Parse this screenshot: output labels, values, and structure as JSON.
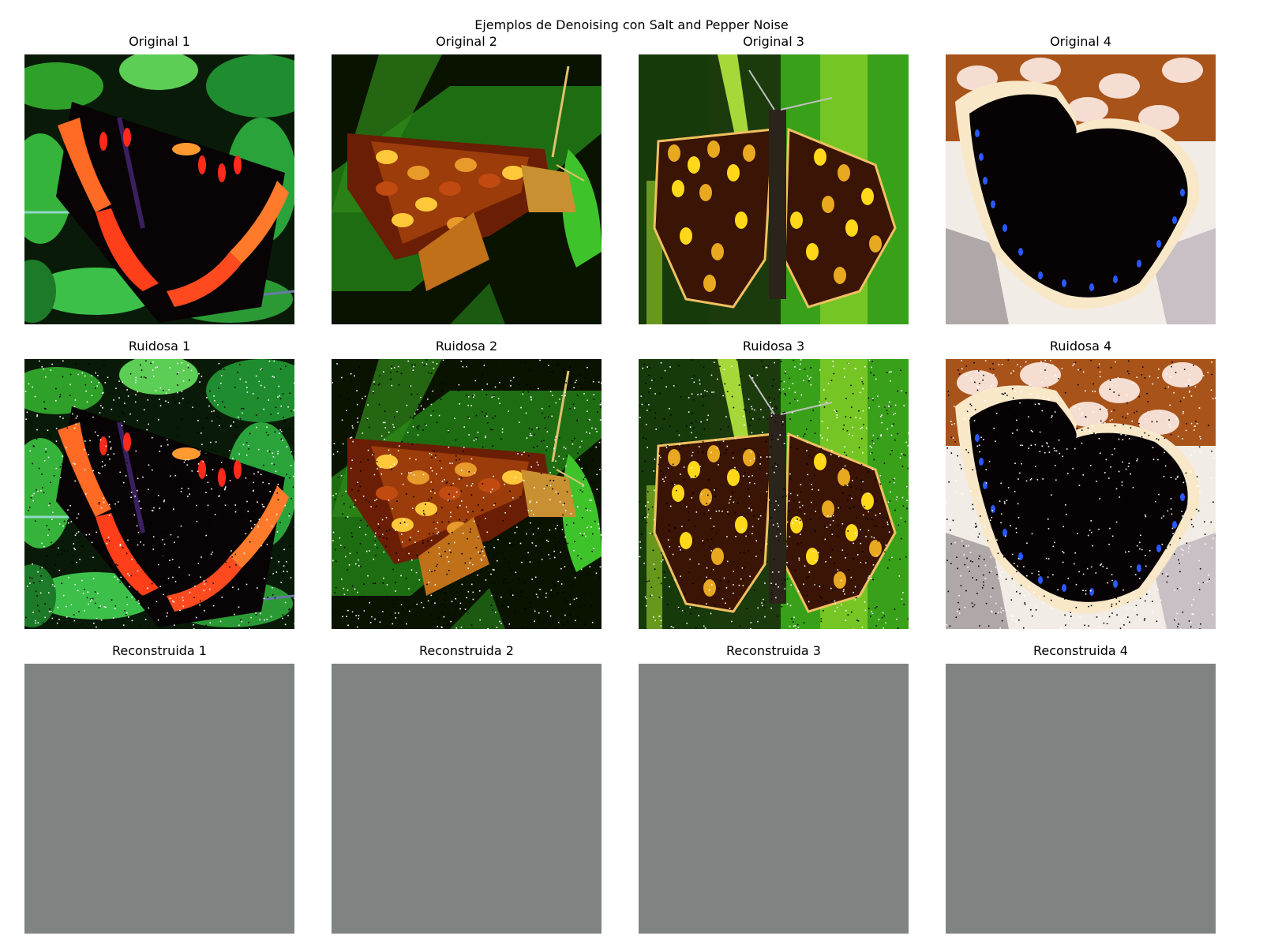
{
  "figure": {
    "title": "Ejemplos de Denoising con Salt and Pepper Noise"
  },
  "rows": [
    {
      "kind": "original",
      "panels": [
        {
          "title": "Original 1",
          "image": "red-admiral-butterfly-on-green-leaves"
        },
        {
          "title": "Original 2",
          "image": "skipper-butterfly-side-view-on-green"
        },
        {
          "title": "Original 3",
          "image": "checkered-skipper-open-wings-on-green"
        },
        {
          "title": "Original 4",
          "image": "mourning-cloak-butterfly-on-bark"
        }
      ]
    },
    {
      "kind": "noisy",
      "panels": [
        {
          "title": "Ruidosa 1",
          "image": "red-admiral-butterfly-salt-and-pepper-noise"
        },
        {
          "title": "Ruidosa 2",
          "image": "skipper-butterfly-salt-and-pepper-noise"
        },
        {
          "title": "Ruidosa 3",
          "image": "checkered-skipper-salt-and-pepper-noise"
        },
        {
          "title": "Ruidosa 4",
          "image": "mourning-cloak-salt-and-pepper-noise"
        }
      ]
    },
    {
      "kind": "reconstructed",
      "panels": [
        {
          "title": "Reconstruida 1",
          "image": "uniform-gray-reconstruction"
        },
        {
          "title": "Reconstruida 2",
          "image": "uniform-gray-reconstruction"
        },
        {
          "title": "Reconstruida 3",
          "image": "uniform-gray-reconstruction"
        },
        {
          "title": "Reconstruida 4",
          "image": "uniform-gray-reconstruction"
        }
      ]
    }
  ],
  "colors": {
    "reconstruction_gray": "#7f8382",
    "salt": "#ffffff",
    "pepper": "#000000"
  }
}
